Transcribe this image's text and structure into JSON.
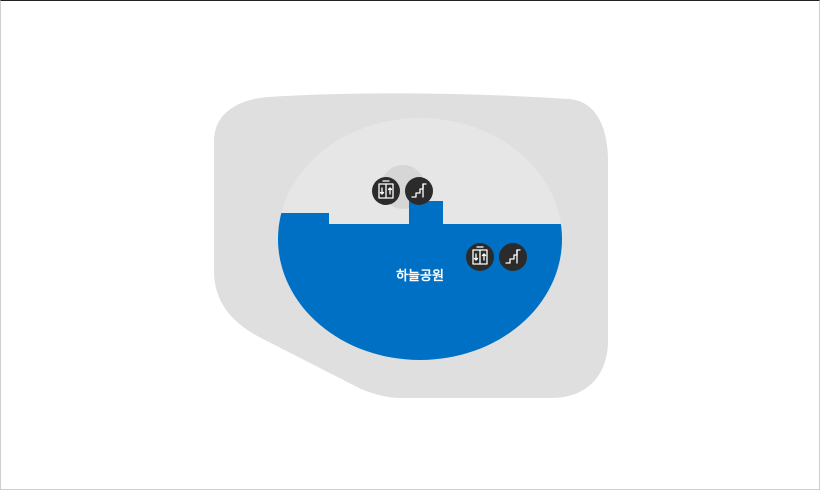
{
  "map": {
    "zone_label": "하늘공원",
    "colors": {
      "outer_land": "#dfdfdf",
      "inner_area": "#e6e6e6",
      "water_zone": "#0070c4",
      "icon_badge": "#2b2b2b",
      "icon_glyph": "#ffffff",
      "page_background": "#ffffff"
    },
    "icons": [
      {
        "name": "elevator-icon",
        "type": "elevator"
      },
      {
        "name": "stairs-icon",
        "type": "stairs"
      },
      {
        "name": "elevator-icon",
        "type": "elevator"
      },
      {
        "name": "stairs-icon",
        "type": "stairs"
      }
    ]
  }
}
